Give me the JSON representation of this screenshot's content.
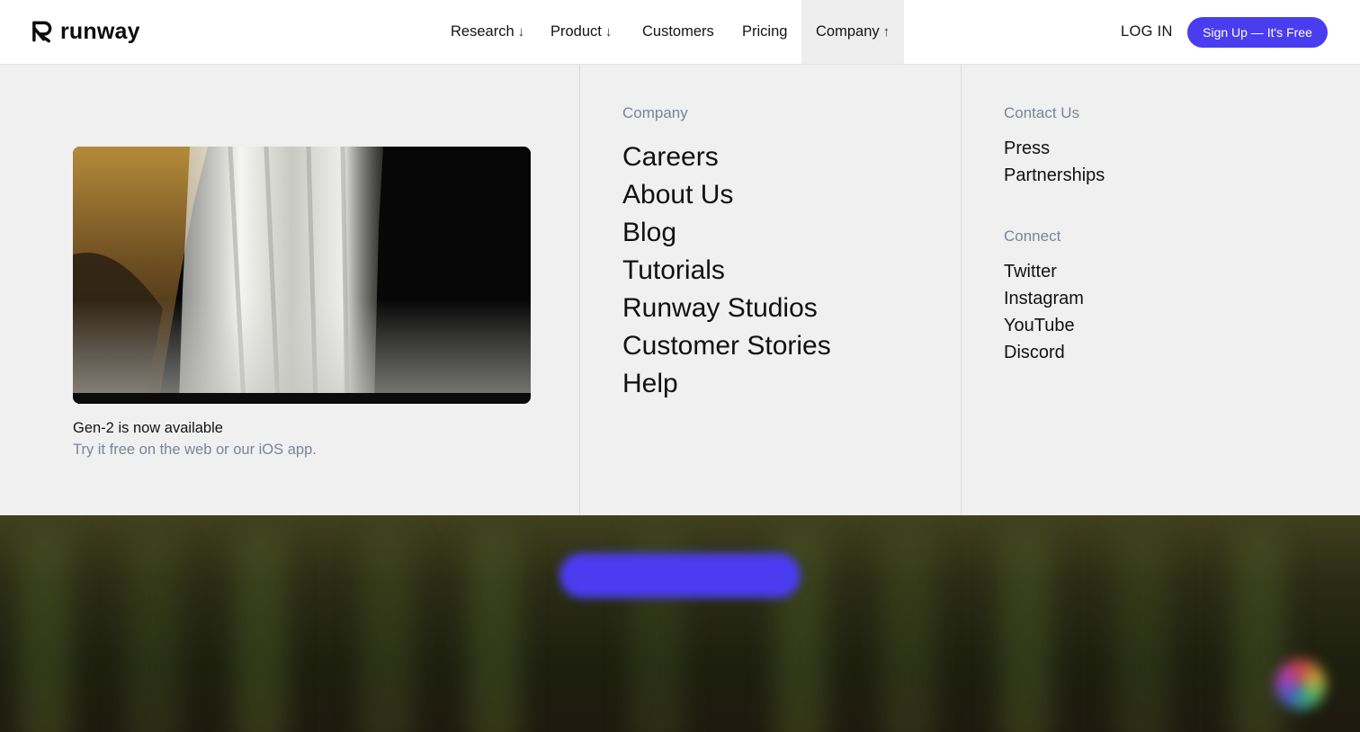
{
  "header": {
    "brand": "runway",
    "nav": [
      {
        "label": "Research",
        "arrow": "↓"
      },
      {
        "label": "Product",
        "arrow": "↓"
      },
      {
        "label": "Customers",
        "arrow": ""
      },
      {
        "label": "Pricing",
        "arrow": ""
      },
      {
        "label": "Company",
        "arrow": "↑"
      }
    ],
    "login_label": "LOG IN",
    "signup_label": "Sign Up — It's Free"
  },
  "menu": {
    "promo": {
      "title": "Gen-2 is now available",
      "subtitle": "Try it free on the web or our iOS app."
    },
    "company": {
      "heading": "Company",
      "links": [
        "Careers",
        "About Us",
        "Blog",
        "Tutorials",
        "Runway Studios",
        "Customer Stories",
        "Help"
      ]
    },
    "contact": {
      "heading": "Contact Us",
      "links": [
        "Press",
        "Partnerships"
      ]
    },
    "connect": {
      "heading": "Connect",
      "links": [
        "Twitter",
        "Instagram",
        "YouTube",
        "Discord"
      ]
    }
  },
  "colors": {
    "accent": "#4a3df0",
    "muted_text": "#7a8595",
    "panel_bg": "#f0f0f0"
  }
}
